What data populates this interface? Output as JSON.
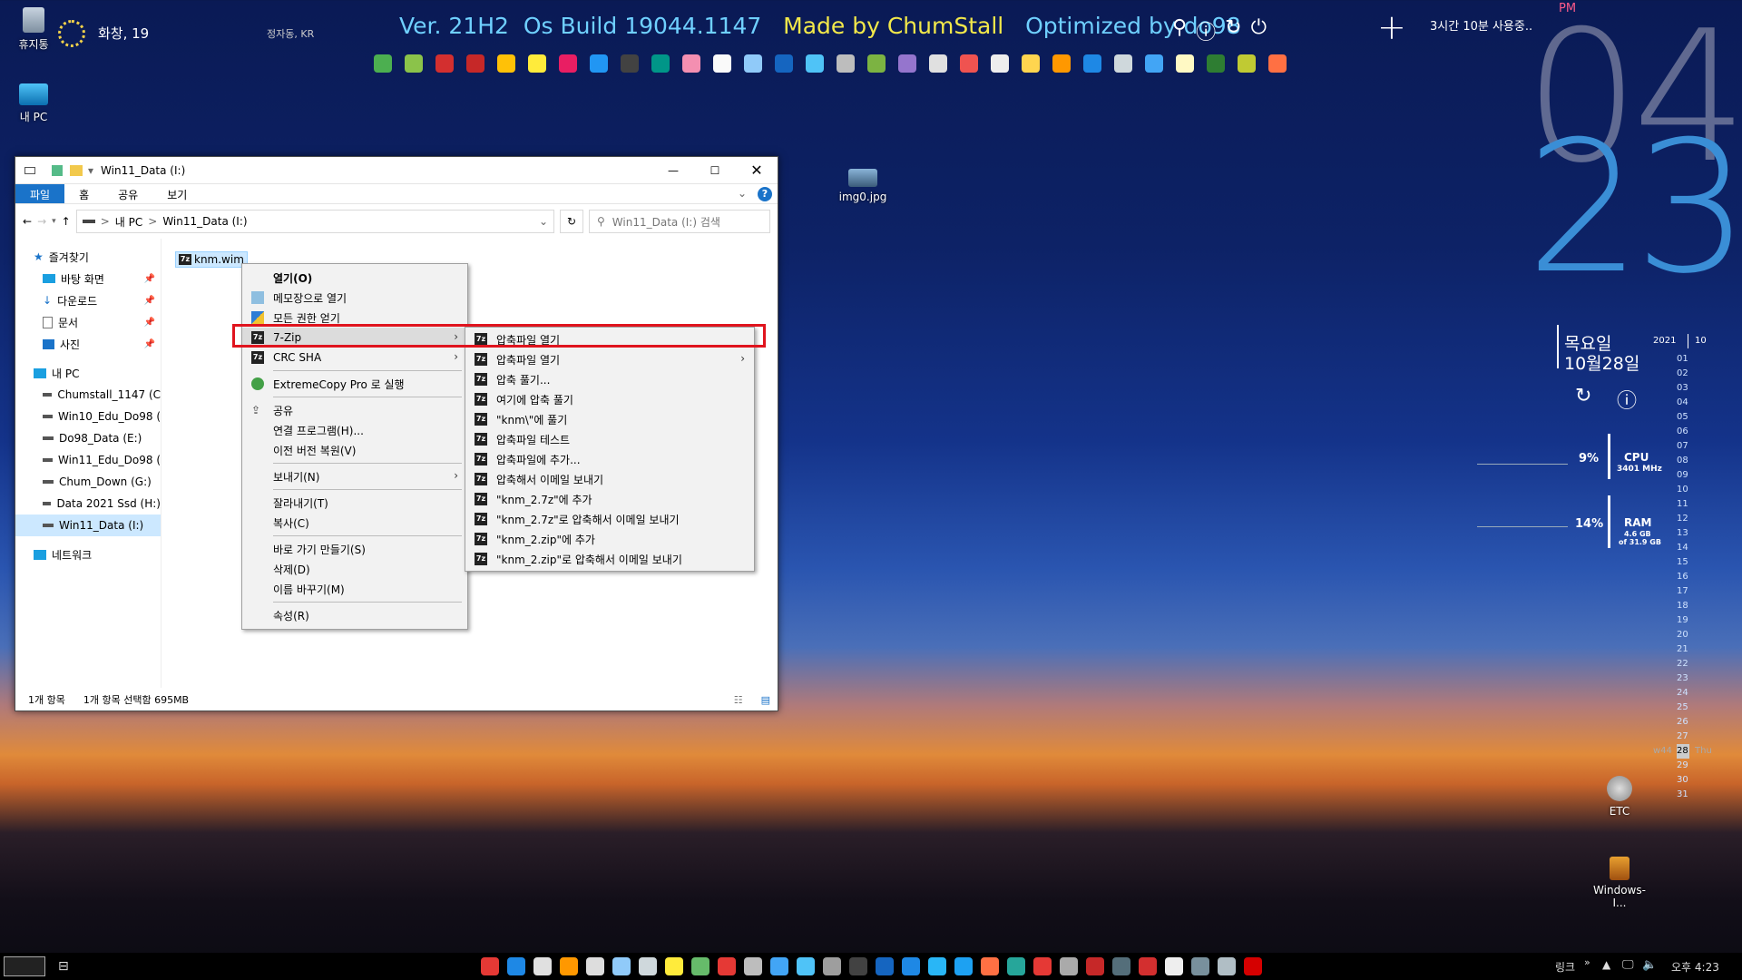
{
  "desktop": {
    "icons": [
      {
        "label": "휴지통"
      },
      {
        "label": "내 PC"
      },
      {
        "label": "img0.jpg"
      },
      {
        "label": "ETC"
      },
      {
        "label": "Windows-I..."
      }
    ],
    "weather": {
      "text": "화창, 19",
      "location": "정자동, KR"
    },
    "banner": {
      "ver": "Ver. 21H2",
      "build": "Os Build 19044.1147",
      "made": "Made by ChumStall",
      "opt": "Optimized by do98"
    },
    "session": "3시간 10분 사용중..",
    "clock": {
      "ampm": "PM",
      "hh": "04",
      "mm": "23",
      "weekday": "목요일",
      "date": "10월28일"
    },
    "calendar": {
      "year": "2021",
      "month": "10",
      "days": [
        "01",
        "02",
        "03",
        "04",
        "05",
        "06",
        "07",
        "08",
        "09",
        "10",
        "11",
        "12",
        "13",
        "14",
        "15",
        "16",
        "17",
        "18",
        "19",
        "20",
        "21",
        "22",
        "23",
        "24",
        "25",
        "26",
        "27",
        "28",
        "29",
        "30",
        "31"
      ],
      "week_label": "w44",
      "today": "28",
      "today_day": "Thu"
    },
    "cpu": {
      "percent": "9%",
      "label": "CPU",
      "freq": "3401 MHz"
    },
    "ram": {
      "percent": "14%",
      "label": "RAM",
      "used": "4.6 GB",
      "of": "of 31.9 GB"
    }
  },
  "explorer": {
    "title": "Win11_Data (I:)",
    "tabs": [
      "파일",
      "홈",
      "공유",
      "보기"
    ],
    "address": {
      "pc": "내 PC",
      "sep": ">",
      "drive": "Win11_Data (I:)"
    },
    "search_placeholder": "Win11_Data (I:) 검색",
    "nav": {
      "quick_access": "즐겨찾기",
      "quick_items": [
        "바탕 화면",
        "다운로드",
        "문서",
        "사진"
      ],
      "pc": "내 PC",
      "drives": [
        "Chumstall_1147 (C",
        "Win10_Edu_Do98 (",
        "Do98_Data (E:)",
        "Win11_Edu_Do98 (",
        "Chum_Down (G:)",
        "Data 2021 Ssd (H:)",
        "Win11_Data (I:)"
      ],
      "network": "네트워크"
    },
    "file": {
      "name": "knm.wim"
    },
    "status": {
      "count": "1개 항목",
      "selected": "1개 항목 선택함 695MB"
    }
  },
  "context_menu": {
    "items": [
      "열기(O)",
      "메모장으로 열기",
      "모든 권한 얻기",
      "7-Zip",
      "CRC SHA",
      "ExtremeCopy Pro 로 실행",
      "공유",
      "연결 프로그램(H)...",
      "이전 버전 복원(V)",
      "보내기(N)",
      "잘라내기(T)",
      "복사(C)",
      "바로 가기 만들기(S)",
      "삭제(D)",
      "이름 바꾸기(M)",
      "속성(R)"
    ]
  },
  "submenu_7zip": {
    "items": [
      "압축파일 열기",
      "압축파일 열기",
      "압축 풀기...",
      "여기에 압축 풀기",
      "\"knm\\\"에 풀기",
      "압축파일 테스트",
      "압축파일에 추가...",
      "압축해서 이메일 보내기",
      "\"knm_2.7z\"에 추가",
      "\"knm_2.7z\"로 압축해서 이메일 보내기",
      "\"knm_2.zip\"에 추가",
      "\"knm_2.zip\"로 압축해서 이메일 보내기"
    ]
  },
  "taskbar": {
    "link_label": "링크",
    "time": "오후 4:23"
  },
  "colors": {
    "highlight_border": "#e0141e",
    "banner_blue": "#6fd0ff",
    "banner_yellow": "#f2e84a",
    "clock_blue": "#3a8ed6"
  }
}
